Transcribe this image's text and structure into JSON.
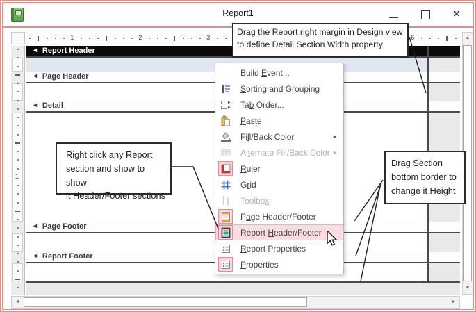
{
  "window": {
    "title": "Report1"
  },
  "ruler": {
    "h_numbers": [
      {
        "label": "1",
        "inch": 1
      },
      {
        "label": "2",
        "inch": 2
      },
      {
        "label": "3",
        "inch": 3
      },
      {
        "label": "6",
        "inch": 6
      }
    ],
    "v_number": "1"
  },
  "sections": [
    {
      "label": "Report Header",
      "selected": true
    },
    {
      "label": "Page Header",
      "selected": false
    },
    {
      "label": "Detail",
      "selected": false
    },
    {
      "label": "Page Footer",
      "selected": false
    },
    {
      "label": "Report Footer",
      "selected": false
    }
  ],
  "menu": {
    "items": [
      {
        "label": "Build Event...",
        "accel": 6,
        "state": "normal",
        "submenu": false
      },
      {
        "label": "Sorting and Grouping",
        "accel": 0,
        "state": "normal",
        "submenu": false
      },
      {
        "label": "Tab Order...",
        "accel": 2,
        "state": "normal",
        "submenu": false
      },
      {
        "label": "Paste",
        "accel": 0,
        "state": "normal",
        "submenu": false
      },
      {
        "label": "Fill/Back Color",
        "accel": 2,
        "state": "normal",
        "submenu": true
      },
      {
        "label": "Alternate Fill/Back Color",
        "accel": 2,
        "state": "disabled",
        "submenu": true
      },
      {
        "label": "Ruler",
        "accel": 0,
        "state": "normal",
        "submenu": false
      },
      {
        "label": "Grid",
        "accel": 1,
        "state": "normal",
        "submenu": false
      },
      {
        "label": "Toolbox",
        "accel": 6,
        "state": "disabled",
        "submenu": false
      },
      {
        "label": "Page Header/Footer",
        "accel": 1,
        "state": "normal",
        "submenu": false
      },
      {
        "label": "Report Header/Footer",
        "accel": 7,
        "state": "highlighted",
        "submenu": false
      },
      {
        "label": "Report Properties",
        "accel": 0,
        "state": "normal",
        "submenu": false
      },
      {
        "label": "Properties",
        "accel": 0,
        "state": "normal",
        "submenu": false
      }
    ]
  },
  "callouts": {
    "top": {
      "lines": [
        "Drag the Report right margin in Design view",
        "to define Detail Section Width property"
      ]
    },
    "left": {
      "lines": [
        "Right click any Report",
        "section and show to show",
        "it Header/Footer sections"
      ]
    },
    "right": {
      "lines": [
        "Drag Section",
        "bottom border to",
        "change it Height"
      ]
    }
  },
  "colors": {
    "frame": "#dd8f8f",
    "selected_section_bar": "#0a0a0a",
    "report_header_section_bg": "#e2e6f1",
    "menu_highlight": "#fbdce2",
    "menu_highlight_border": "#efadb9",
    "icon_box_bg": "#fbd6dc",
    "icon_box_border": "#de8e9c"
  }
}
